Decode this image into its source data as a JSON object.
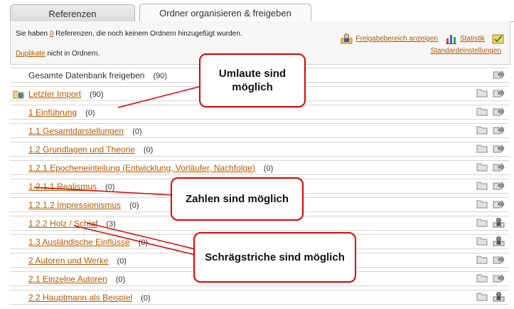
{
  "tabs": [
    {
      "label": "Referenzen",
      "active": false
    },
    {
      "label": "Ordner organisieren & freigeben",
      "active": true
    }
  ],
  "info": {
    "line1_pre": "Sie haben ",
    "line1_count": "0",
    "line1_post": " Referenzen, die noch keinem Ordnern hinzugefügt wurden.",
    "duplicates_link": "Duplikate",
    "line2_post": " nicht in Ordnern."
  },
  "toolbar": {
    "share_area": "Freigabebereich anzeigen",
    "statistics": "Statistik",
    "default_settings": "Standardeinstellungen"
  },
  "tree": [
    {
      "label": "Gesamte Datenbank freigeben",
      "count": "(90)",
      "link": false
    },
    {
      "label": "Letzter Import",
      "count": "(90)",
      "link": true
    },
    {
      "label": "1 Einführung",
      "count": "(0)",
      "link": true
    },
    {
      "label": "1.1 Gesamtdarstellungen",
      "count": "(0)",
      "link": true
    },
    {
      "label": "1.2 Grundlagen und Theorie",
      "count": "(0)",
      "link": true
    },
    {
      "label": "1.2.1 Epocheneinteilung (Entwicklung, Vorläufer, Nachfolge)",
      "count": "(0)",
      "link": true
    },
    {
      "label": "1.2.1.1 Realismus",
      "count": "(0)",
      "link": true
    },
    {
      "label": "1.2.1.2 Impressionismus",
      "count": "(0)",
      "link": true
    },
    {
      "label": "1.2.2 Holz / Schlaf",
      "count": "(3)",
      "link": true
    },
    {
      "label": "1.3 Ausländische Einflüsse",
      "count": "(0)",
      "link": true
    },
    {
      "label": "2 Autoren und Werke",
      "count": "(0)",
      "link": true
    },
    {
      "label": "2.1 Einzelne Autoren",
      "count": "(0)",
      "link": true
    },
    {
      "label": "2.2 Hauptmann als Beispiel",
      "count": "(0)",
      "link": true
    }
  ],
  "callouts": {
    "umlaute": "Umlaute sind möglich",
    "zahlen": "Zahlen sind möglich",
    "schraeg": "Schrägstriche sind möglich"
  }
}
